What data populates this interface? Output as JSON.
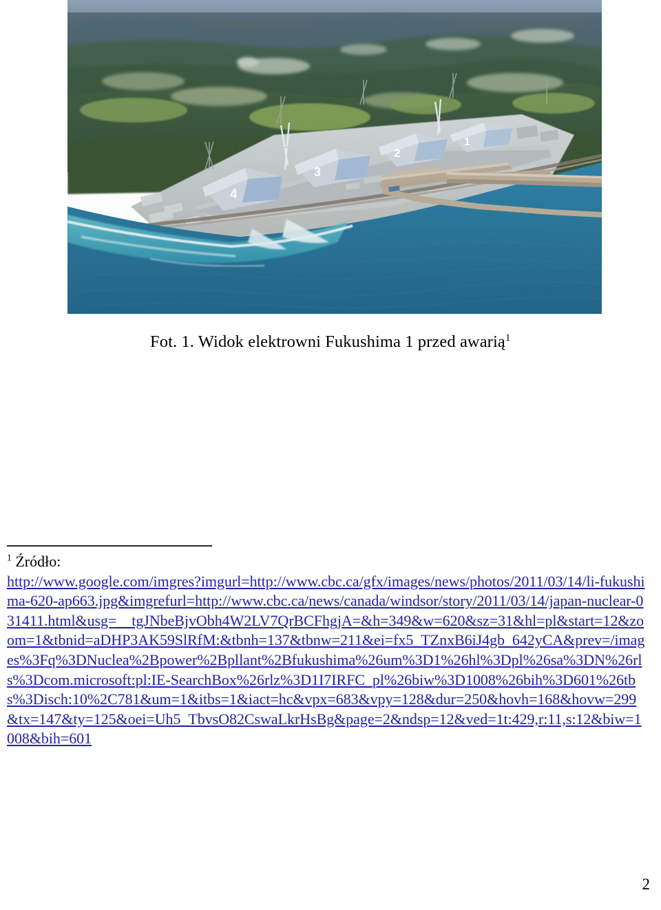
{
  "document": {
    "language": "pl",
    "page_number": "2"
  },
  "figure": {
    "alt_name": "aerial-photo-fukushima-daiichi",
    "reactor_labels": [
      "1",
      "2",
      "3",
      "4"
    ],
    "colors": {
      "sky_haze": "#9fb0c8",
      "forest_dark": "#2f4a33",
      "forest_mid": "#47603f",
      "field_green": "#7f9a4e",
      "ocean_deep": "#1f6f96",
      "ocean_mid": "#2c87ab",
      "ocean_shallow": "#4fb3c4",
      "surf_white": "#e9f2f4",
      "building_light": "#d8dde2",
      "building_blue": "#9db6d2",
      "breakwater": "#b9ab96",
      "road_grey": "#8c8377"
    }
  },
  "caption": {
    "text_before": "Fot. 1. Widok elektrowni Fukushima 1 przed awarią",
    "superscript": "1"
  },
  "footnote": {
    "marker": "1",
    "label": "Źródło:",
    "url": "http://www.google.com/imgres?imgurl=http://www.cbc.ca/gfx/images/news/photos/2011/03/14/li-fukushima-620-ap663.jpg&imgrefurl=http://www.cbc.ca/news/canada/windsor/story/2011/03/14/japan-nuclear-031411.html&usg=__tgJNbeBjvObh4W2LV7QrBCFhgjA=&h=349&w=620&sz=31&hl=pl&start=12&zoom=1&tbnid=aDHP3AK59SlRfM:&tbnh=137&tbnw=211&ei=fx5_TZnxB6iJ4gb_642yCA&prev=/images%3Fq%3DNuclea%2Bpower%2Bpllant%2Bfukushima%26um%3D1%26hl%3Dpl%26sa%3DN%26rls%3Dcom.microsoft:pl:IE-SearchBox%26rlz%3D1I7IRFC_pl%26biw%3D1008%26bih%3D601%26tbs%3Disch:10%2C781&um=1&itbs=1&iact=hc&vpx=683&vpy=128&dur=250&hovh=168&hovw=299&tx=147&ty=125&oei=Uh5_TbvsO82CswaLkrHsBg&page=2&ndsp=12&ved=1t:429,r:11,s:12&biw=1008&bih=601"
  }
}
